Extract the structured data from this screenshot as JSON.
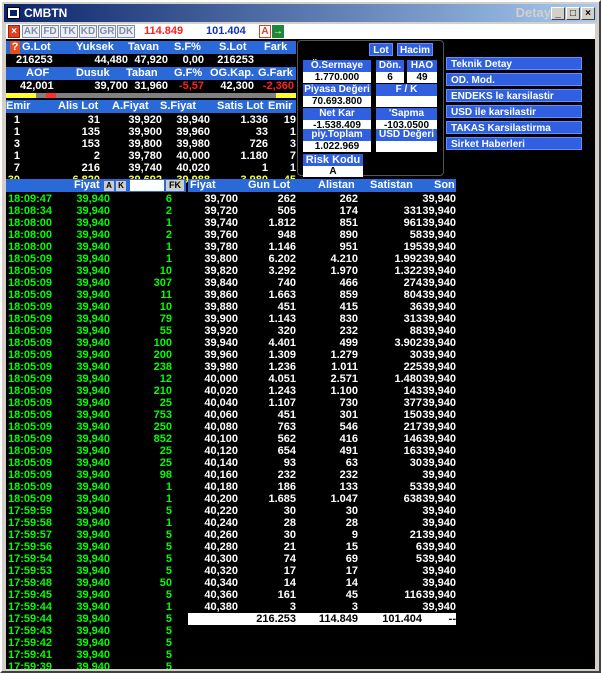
{
  "window": {
    "title": "CMBTN",
    "detail": "Detay",
    "controls": [
      "_",
      "□",
      "×"
    ]
  },
  "toolbar": {
    "close": "×",
    "tabs": [
      "AK",
      "FD",
      "TK",
      "KD",
      "GR",
      "DK"
    ],
    "value_red": "114.849",
    "value_blue": "101.404",
    "a_btn": "A",
    "arrow": "→"
  },
  "summary": {
    "row1_headers": [
      "G.Lot",
      "Yuksek",
      "Tavan",
      "S.F%",
      "S.Lot",
      "Fark"
    ],
    "row1_values": [
      "216253",
      "44,480",
      "47,920",
      "0,00",
      "216253",
      ""
    ],
    "row2_headers": [
      "AOF",
      "Dusuk",
      "Taban",
      "G.F%",
      "OG.Kap.",
      "G.Fark"
    ],
    "row2_values": [
      "42,001",
      "39,700",
      "31,960",
      "-5,57",
      "42,300",
      "-2,360"
    ]
  },
  "depth": {
    "headers": [
      "Emir",
      "Alis Lot",
      "A.Fiyat",
      "S.Fiyat",
      "Satis Lot",
      "Emir"
    ],
    "rows": [
      [
        "1",
        "31",
        "39,920",
        "39,940",
        "1.336",
        "19"
      ],
      [
        "1",
        "135",
        "39,900",
        "39,960",
        "33",
        "1"
      ],
      [
        "3",
        "153",
        "39,800",
        "39,980",
        "726",
        "3"
      ],
      [
        "1",
        "2",
        "39,780",
        "40,000",
        "1.180",
        "7"
      ],
      [
        "7",
        "216",
        "39,740",
        "40,020",
        "1",
        "1"
      ]
    ],
    "total": [
      "30",
      "6.820",
      "39,692",
      "39,988",
      "3.980",
      "45"
    ]
  },
  "panel": {
    "lot_btn": "Lot",
    "hacim_btn": "Hacim",
    "osermaye_label": "Ö.Sermaye",
    "osermaye_value": "1.770.000",
    "don_label": "Dön.",
    "don_value": "6",
    "hao_label": "HAO",
    "hao_value": "49",
    "piyasa_label": "Piyasa Değeri",
    "piyasa_value": "70.693.800",
    "fk_label": "F / K",
    "fk_value": "",
    "netkar_label": "Net Kar",
    "netkar_value": "-1.538.409",
    "sapma_label": "'Sapma",
    "sapma_value": "-103.0500",
    "ptl_label": "piy.Toplam Lot",
    "ptl_value": "1.022.969",
    "usd_label": "USD Değeri",
    "usd_value": "",
    "risk_label": "Risk Kodu",
    "risk_value": "A"
  },
  "menu": [
    "Teknik Detay",
    "OD. Mod.",
    "ENDEKS le karsilastir",
    "USD ile karsilastir",
    "TAKAS Karsilastirma",
    "Sirket Haberleri"
  ],
  "trades": {
    "header_price": "Fiyat",
    "btn_a": "A",
    "btn_k": "K",
    "btn_fk": "FK",
    "rows": [
      [
        "18:09:47",
        "39,940",
        "6"
      ],
      [
        "18:08:34",
        "39,940",
        "2"
      ],
      [
        "18:08:00",
        "39,940",
        "1"
      ],
      [
        "18:08:00",
        "39,940",
        "2"
      ],
      [
        "18:08:00",
        "39,940",
        "1"
      ],
      [
        "18:05:09",
        "39,940",
        "1"
      ],
      [
        "18:05:09",
        "39,940",
        "10"
      ],
      [
        "18:05:09",
        "39,940",
        "307"
      ],
      [
        "18:05:09",
        "39,940",
        "11"
      ],
      [
        "18:05:09",
        "39,940",
        "10"
      ],
      [
        "18:05:09",
        "39,940",
        "79"
      ],
      [
        "18:05:09",
        "39,940",
        "55"
      ],
      [
        "18:05:09",
        "39,940",
        "100"
      ],
      [
        "18:05:09",
        "39,940",
        "200"
      ],
      [
        "18:05:09",
        "39,940",
        "238"
      ],
      [
        "18:05:09",
        "39,940",
        "12"
      ],
      [
        "18:05:09",
        "39,940",
        "210"
      ],
      [
        "18:05:09",
        "39,940",
        "25"
      ],
      [
        "18:05:09",
        "39,940",
        "753"
      ],
      [
        "18:05:09",
        "39,940",
        "250"
      ],
      [
        "18:05:09",
        "39,940",
        "852"
      ],
      [
        "18:05:09",
        "39,940",
        "25"
      ],
      [
        "18:05:09",
        "39,940",
        "25"
      ],
      [
        "18:05:09",
        "39,940",
        "98"
      ],
      [
        "18:05:09",
        "39,940",
        "1"
      ],
      [
        "18:05:09",
        "39,940",
        "1"
      ],
      [
        "17:59:59",
        "39,940",
        "5"
      ],
      [
        "17:59:58",
        "39,940",
        "1"
      ],
      [
        "17:59:57",
        "39,940",
        "5"
      ],
      [
        "17:59:56",
        "39,940",
        "5"
      ],
      [
        "17:59:54",
        "39,940",
        "5"
      ],
      [
        "17:59:53",
        "39,940",
        "5"
      ],
      [
        "17:59:48",
        "39,940",
        "50"
      ],
      [
        "17:59:45",
        "39,940",
        "5"
      ],
      [
        "17:59:44",
        "39,940",
        "1"
      ],
      [
        "17:59:44",
        "39,940",
        "5"
      ],
      [
        "17:59:43",
        "39,940",
        "5"
      ],
      [
        "17:59:42",
        "39,940",
        "5"
      ],
      [
        "17:59:41",
        "39,940",
        "5"
      ],
      [
        "17:59:39",
        "39,940",
        "5"
      ]
    ]
  },
  "daily": {
    "headers": [
      "Fiyat",
      "Gun Lot",
      "Alistan",
      "Satistan",
      "Son"
    ],
    "rows": [
      [
        "39,700",
        "262",
        "262",
        "",
        "39,940"
      ],
      [
        "39,720",
        "505",
        "174",
        "331",
        "39,940"
      ],
      [
        "39,740",
        "1.812",
        "851",
        "961",
        "39,940"
      ],
      [
        "39,760",
        "948",
        "890",
        "58",
        "39,940"
      ],
      [
        "39,780",
        "1.146",
        "951",
        "195",
        "39,940"
      ],
      [
        "39,800",
        "6.202",
        "4.210",
        "1.992",
        "39,940"
      ],
      [
        "39,820",
        "3.292",
        "1.970",
        "1.322",
        "39,940"
      ],
      [
        "39,840",
        "740",
        "466",
        "274",
        "39,940"
      ],
      [
        "39,860",
        "1.663",
        "859",
        "804",
        "39,940"
      ],
      [
        "39,880",
        "451",
        "415",
        "36",
        "39,940"
      ],
      [
        "39,900",
        "1.143",
        "830",
        "313",
        "39,940"
      ],
      [
        "39,920",
        "320",
        "232",
        "88",
        "39,940"
      ],
      [
        "39,940",
        "4.401",
        "499",
        "3.902",
        "39,940"
      ],
      [
        "39,960",
        "1.309",
        "1.279",
        "30",
        "39,940"
      ],
      [
        "39,980",
        "1.236",
        "1.011",
        "225",
        "39,940"
      ],
      [
        "40,000",
        "4.051",
        "2.571",
        "1.480",
        "39,940"
      ],
      [
        "40,020",
        "1.243",
        "1.100",
        "143",
        "39,940"
      ],
      [
        "40,040",
        "1.107",
        "730",
        "377",
        "39,940"
      ],
      [
        "40,060",
        "451",
        "301",
        "150",
        "39,940"
      ],
      [
        "40,080",
        "763",
        "546",
        "217",
        "39,940"
      ],
      [
        "40,100",
        "562",
        "416",
        "146",
        "39,940"
      ],
      [
        "40,120",
        "654",
        "491",
        "163",
        "39,940"
      ],
      [
        "40,140",
        "93",
        "63",
        "30",
        "39,940"
      ],
      [
        "40,160",
        "232",
        "232",
        "",
        "39,940"
      ],
      [
        "40,180",
        "186",
        "133",
        "53",
        "39,940"
      ],
      [
        "40,200",
        "1.685",
        "1.047",
        "638",
        "39,940"
      ],
      [
        "40,220",
        "30",
        "30",
        "",
        "39,940"
      ],
      [
        "40,240",
        "28",
        "28",
        "",
        "39,940"
      ],
      [
        "40,260",
        "30",
        "9",
        "21",
        "39,940"
      ],
      [
        "40,280",
        "21",
        "15",
        "6",
        "39,940"
      ],
      [
        "40,300",
        "74",
        "69",
        "5",
        "39,940"
      ],
      [
        "40,320",
        "17",
        "17",
        "",
        "39,940"
      ],
      [
        "40,340",
        "14",
        "14",
        "",
        "39,940"
      ],
      [
        "40,360",
        "161",
        "45",
        "116",
        "39,940"
      ],
      [
        "40,380",
        "3",
        "3",
        "",
        "39,940"
      ]
    ],
    "totals": [
      "",
      "216.253",
      "114.849",
      "101.404",
      "--"
    ]
  }
}
